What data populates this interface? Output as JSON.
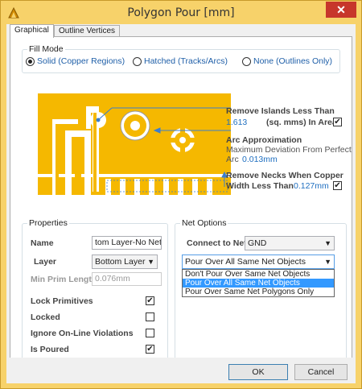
{
  "window": {
    "title": "Polygon Pour [mm]",
    "close_glyph": "✕"
  },
  "tabs": [
    {
      "label": "Graphical",
      "active": true
    },
    {
      "label": "Outline Vertices",
      "active": false
    }
  ],
  "fill_mode": {
    "title": "Fill Mode",
    "options": [
      {
        "label": "Solid (Copper Regions)",
        "selected": true
      },
      {
        "label": "Hatched (Tracks/Arcs)",
        "selected": false
      },
      {
        "label": "None (Outlines Only)",
        "selected": false
      }
    ]
  },
  "graphic": {
    "remove_islands": {
      "title": "Remove Islands Less Than",
      "value": "1.613",
      "unit": "(sq. mms) In Area",
      "checked": true
    },
    "arc_approx": {
      "title": "Arc Approximation",
      "desc": "Maximum Deviation From Perfect",
      "prefix": "Arc",
      "value": "0.013mm"
    },
    "remove_necks": {
      "title": "Remove Necks When Copper",
      "label": "Width Less Than",
      "value": "0.127mm",
      "checked": true
    },
    "copper_color": "#f5b800"
  },
  "properties": {
    "title": "Properties",
    "name_label": "Name",
    "name_value": "tom Layer-No Net",
    "layer_label": "Layer",
    "layer_value": "Bottom Layer",
    "min_prim_label": "Min Prim Length",
    "min_prim_value": "0.076mm",
    "checks": [
      {
        "label": "Lock Primitives",
        "checked": true
      },
      {
        "label": "Locked",
        "checked": false
      },
      {
        "label": "Ignore On-Line Violations",
        "checked": false
      },
      {
        "label": "Is Poured",
        "checked": true
      }
    ]
  },
  "net_options": {
    "title": "Net Options",
    "connect_label": "Connect to Net",
    "connect_value": "GND",
    "pour_value": "Pour Over All Same Net Objects",
    "pour_options": [
      {
        "label": "Don't Pour Over Same Net Objects",
        "selected": false
      },
      {
        "label": "Pour Over All Same Net Objects",
        "selected": true
      },
      {
        "label": "Pour Over Same Net Polygons Only",
        "selected": false
      }
    ]
  },
  "footer": {
    "ok_label": "OK",
    "cancel_label": "Cancel"
  },
  "icons": {
    "app": "altium-app-icon",
    "close": "close-icon",
    "dropdown": "chevron-down-icon",
    "check": "check-icon"
  },
  "colors": {
    "title_bar": "#f7d26a",
    "close": "#c7362b",
    "selection": "#3399ff",
    "link_blue": "#1f6fc0"
  }
}
